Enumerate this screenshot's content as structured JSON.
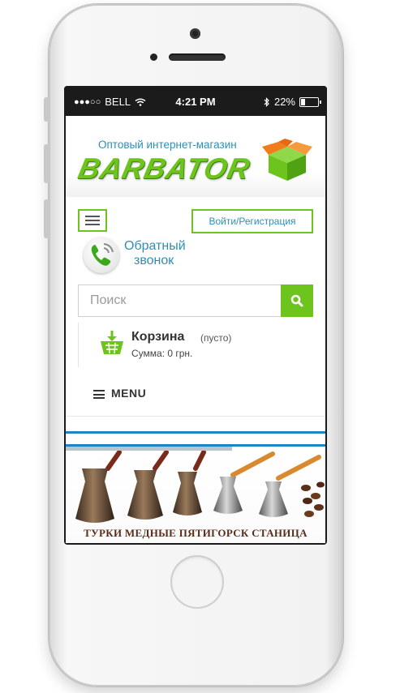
{
  "statusbar": {
    "signal": "●●●○○",
    "carrier": "BELL",
    "time": "4:21 PM",
    "battery": "22%"
  },
  "header": {
    "tagline": "Оптовый интернет-магазин",
    "logo": "BARBATOR"
  },
  "nav": {
    "login_label": "Войти/Регистрация"
  },
  "callback": {
    "line1": "Обратный",
    "line2": "звонок"
  },
  "search": {
    "placeholder": "Поиск"
  },
  "cart": {
    "title": "Корзина",
    "status": "(пусто)",
    "sum": "Сумма: 0 грн."
  },
  "menu": {
    "label": "MENU"
  },
  "banner": {
    "caption": "ТУРКИ МЕДНЫЕ ПЯТИГОРСК СТАНИЦА"
  },
  "colors": {
    "accent_green": "#6cc41d",
    "link_blue": "#2e8fb5",
    "divider_blue": "#1a86c4"
  }
}
